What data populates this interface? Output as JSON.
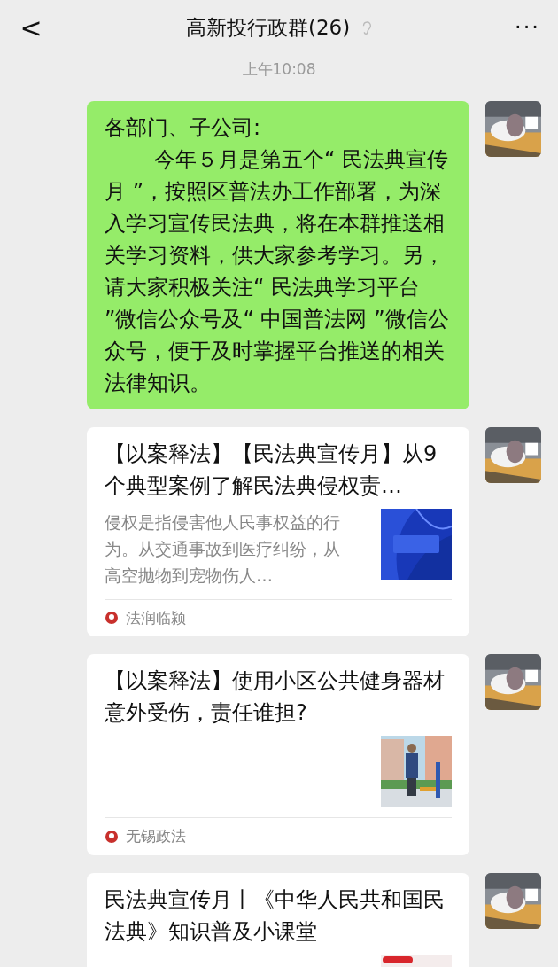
{
  "header": {
    "back": "<",
    "title": "高新投行政群(26)",
    "more": "···"
  },
  "timestamp": "上午10:08",
  "messages": [
    {
      "kind": "text",
      "greeting": "各部门、子公司:",
      "body": "今年５月是第五个“ 民法典宣传月 ”，按照区普法办工作部署，为深入学习宣传民法典，将在本群推送相关学习资料，供大家参考学习。另，请大家积极关注“ 民法典学习平台 ”微信公众号及“ 中国普法网 ”微信公众号，便于及时掌握平台推送的相关法律知识。"
    },
    {
      "kind": "article",
      "title": "【以案释法】【民法典宣传月】从9个典型案例了解民法典侵权责…",
      "description": "侵权是指侵害他人民事权益的行为。从交通事故到医疗纠纷，从高空抛物到宠物伤人…",
      "source": "法润临颍"
    },
    {
      "kind": "article",
      "title": "【以案释法】使用小区公共健身器材意外受伤，责任谁担?",
      "source": "无锡政法"
    },
    {
      "kind": "article",
      "title": "民法典宣传月丨《中华人民共和国民法典》知识普及小课堂"
    }
  ]
}
